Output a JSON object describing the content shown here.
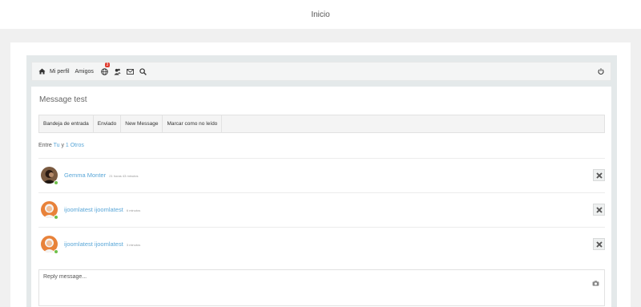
{
  "header": {
    "title": "Inicio"
  },
  "toolbar": {
    "home_icon": "home-icon",
    "profile_label": "Mi perfil",
    "friends_label": "Amigos",
    "globe_badge": "3",
    "logout_icon": "power-icon"
  },
  "conversation": {
    "title": "Message test",
    "tabs": [
      "Bandeja de entrada",
      "Enviado",
      "New Message",
      "Marcar como no leído"
    ],
    "between_prefix": "Entre",
    "between_you": "Tu",
    "between_and": "y",
    "between_others": "1 Otros",
    "messages": [
      {
        "name": "Gemma Monter",
        "time": "21 horas 43 minutos",
        "status": "online"
      },
      {
        "name": "ijoomlatest ijoomlatest",
        "time": "6 minutos",
        "status": "online"
      },
      {
        "name": "ijoomlatest ijoomlatest",
        "time": "3 minutos",
        "status": "online"
      }
    ]
  },
  "reply": {
    "placeholder": "Reply message..."
  },
  "colors": {
    "link": "#5aa7d8",
    "online": "#6ec04a",
    "badge": "#e03a2d"
  }
}
